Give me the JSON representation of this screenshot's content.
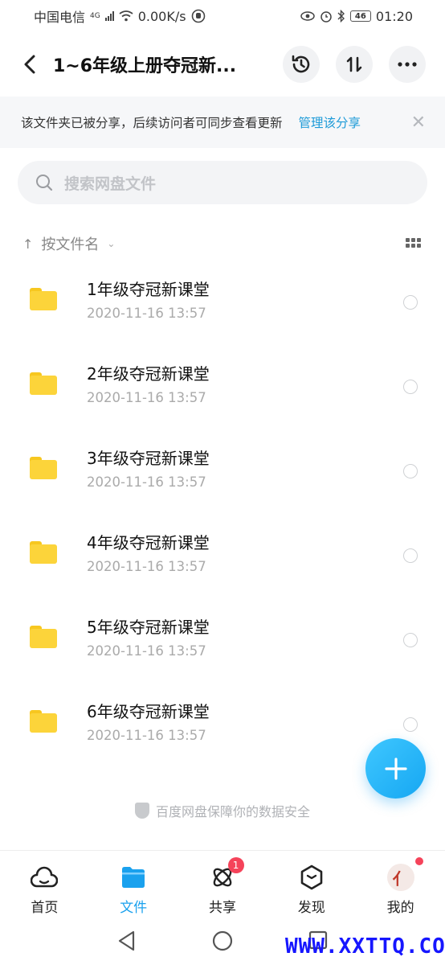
{
  "status_bar": {
    "carrier": "中国电信",
    "network_type": "4G",
    "speed": "0.00K/s",
    "battery": "46",
    "time": "01:20"
  },
  "header": {
    "title": "1~6年级上册夺冠新..."
  },
  "share_notice": {
    "text": "该文件夹已被分享，后续访问者可同步查看更新",
    "link": "管理该分享"
  },
  "search": {
    "placeholder": "搜索网盘文件"
  },
  "sort": {
    "label": "按文件名"
  },
  "files": [
    {
      "name": "1年级夺冠新课堂",
      "date": "2020-11-16  13:57"
    },
    {
      "name": "2年级夺冠新课堂",
      "date": "2020-11-16  13:57"
    },
    {
      "name": "3年级夺冠新课堂",
      "date": "2020-11-16  13:57"
    },
    {
      "name": "4年级夺冠新课堂",
      "date": "2020-11-16  13:57"
    },
    {
      "name": "5年级夺冠新课堂",
      "date": "2020-11-16  13:57"
    },
    {
      "name": "6年级夺冠新课堂",
      "date": "2020-11-16  13:57"
    }
  ],
  "footer_note": "百度网盘保障你的数据安全",
  "tabs": [
    {
      "label": "首页"
    },
    {
      "label": "文件"
    },
    {
      "label": "共享",
      "badge": "1"
    },
    {
      "label": "发现"
    },
    {
      "label": "我的"
    }
  ],
  "watermark": "WWW.XXTTQ.COM",
  "colors": {
    "accent": "#1aa1ee",
    "folder": "#fcd43a",
    "badge": "#f5435a"
  }
}
